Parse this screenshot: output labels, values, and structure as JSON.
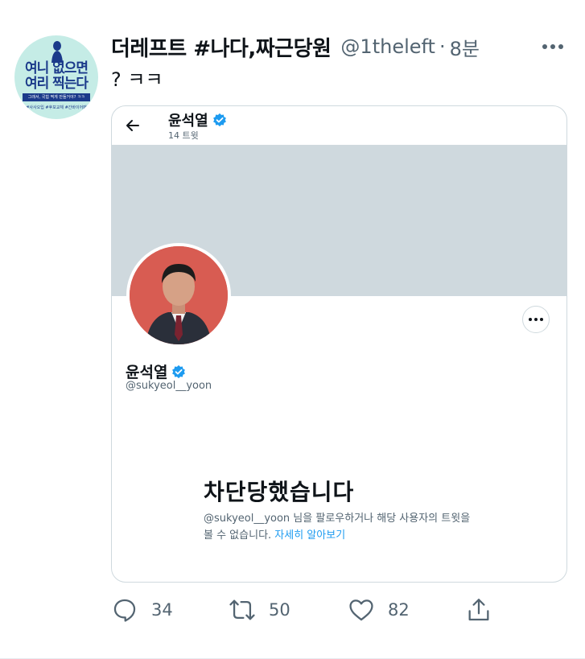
{
  "tweet": {
    "author": {
      "display_name": "더레프트 #나다,짜근당원",
      "handle": "@1theleft",
      "time": "8분",
      "avatar": {
        "line1": "여니 없으면",
        "line2": "여리 찍는다",
        "bar_text": "그래서, 국힘 찍게 만들거야? ㅋㅋ",
        "tags": "#사사오입 #후보교체 #간바이어패"
      }
    },
    "separator": "·",
    "text": "? ㅋㅋ",
    "embedded_card": {
      "header_name": "윤석열",
      "tweet_count": "14 트윗",
      "profile_name": "윤석열",
      "profile_handle": "@sukyeol__yoon",
      "blocked_title": "차단당했습니다",
      "blocked_desc": "@sukyeol__yoon 님을 팔로우하거나 해당 사용자의 트윗을 볼 수 없습니다. ",
      "blocked_link": "자세히 알아보기"
    },
    "actions": {
      "reply_count": "34",
      "retweet_count": "50",
      "like_count": "82"
    },
    "colors": {
      "accent": "#1d9bf0",
      "secondary_text": "#536471",
      "banner": "#cfd9de",
      "avatar_bg": "#c5ece6",
      "profile_pic_bg": "#d85c52"
    }
  }
}
